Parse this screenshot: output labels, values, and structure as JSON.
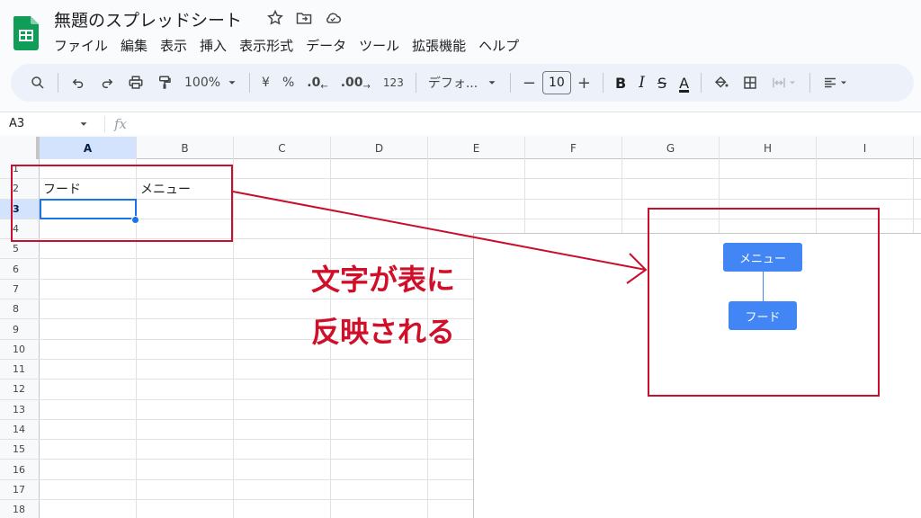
{
  "app": {
    "title": "無題のスプレッドシート",
    "menu": [
      "ファイル",
      "編集",
      "表示",
      "挿入",
      "表示形式",
      "データ",
      "ツール",
      "拡張機能",
      "ヘルプ"
    ]
  },
  "toolbar": {
    "zoom": "100%",
    "currency": "¥",
    "percent": "%",
    "decrease_decimal": ".0",
    "increase_decimal": ".00",
    "number_format": "123",
    "font": "デフォ...",
    "minus": "−",
    "font_size": "10",
    "plus": "+",
    "bold": "B",
    "italic": "I",
    "strike": "S",
    "text_color": "A"
  },
  "formula_bar": {
    "name_box": "A3",
    "fx": "fx"
  },
  "grid": {
    "columns": [
      "A",
      "B",
      "C",
      "D",
      "E",
      "F",
      "G",
      "H",
      "I"
    ],
    "active_column": "A",
    "rows": [
      "1",
      "2",
      "3",
      "4",
      "5",
      "6",
      "7",
      "8",
      "9",
      "10",
      "11",
      "12",
      "13",
      "14",
      "15",
      "16",
      "17",
      "18"
    ],
    "active_row": "3",
    "cells": {
      "A2": "フード",
      "B2": "メニュー"
    }
  },
  "mindmap": {
    "top_node": "メニュー",
    "bottom_node": "フード"
  },
  "annotation": {
    "line1": "文字が表に",
    "line2": "反映される"
  },
  "colors": {
    "annotation_red": "#c8102e",
    "node_blue": "#4285f4",
    "selection_blue": "#1a73e8"
  }
}
